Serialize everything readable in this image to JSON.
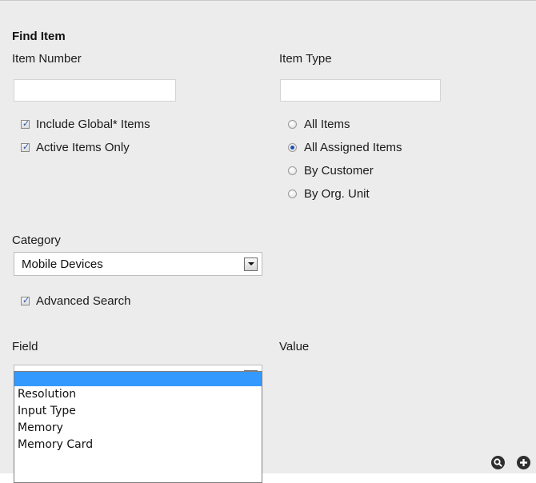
{
  "form": {
    "title": "Find Item",
    "item_number_label": "Item Number",
    "item_number_value": "",
    "item_type_label": "Item Type",
    "item_type_value": ""
  },
  "checkboxes": [
    {
      "label": "Include Global* Items",
      "checked": true
    },
    {
      "label": "Active Items Only",
      "checked": true
    }
  ],
  "radios": [
    {
      "label": "All Items",
      "checked": false
    },
    {
      "label": "All Assigned Items",
      "checked": true
    },
    {
      "label": "By Customer",
      "checked": false
    },
    {
      "label": "By Org. Unit",
      "checked": false
    }
  ],
  "category": {
    "label": "Category",
    "selected": "Mobile Devices"
  },
  "advanced_search": {
    "label": "Advanced Search",
    "checked": true
  },
  "field": {
    "label": "Field",
    "selected": "",
    "options": [
      "",
      "Resolution",
      "Input Type",
      "Memory",
      "Memory Card"
    ]
  },
  "value": {
    "label": "Value"
  },
  "icons": {
    "search": "search-icon",
    "add": "add-icon"
  },
  "colors": {
    "panel_bg": "#ececec",
    "highlight": "#3399ff",
    "radio_selected": "#1f4fb0"
  }
}
